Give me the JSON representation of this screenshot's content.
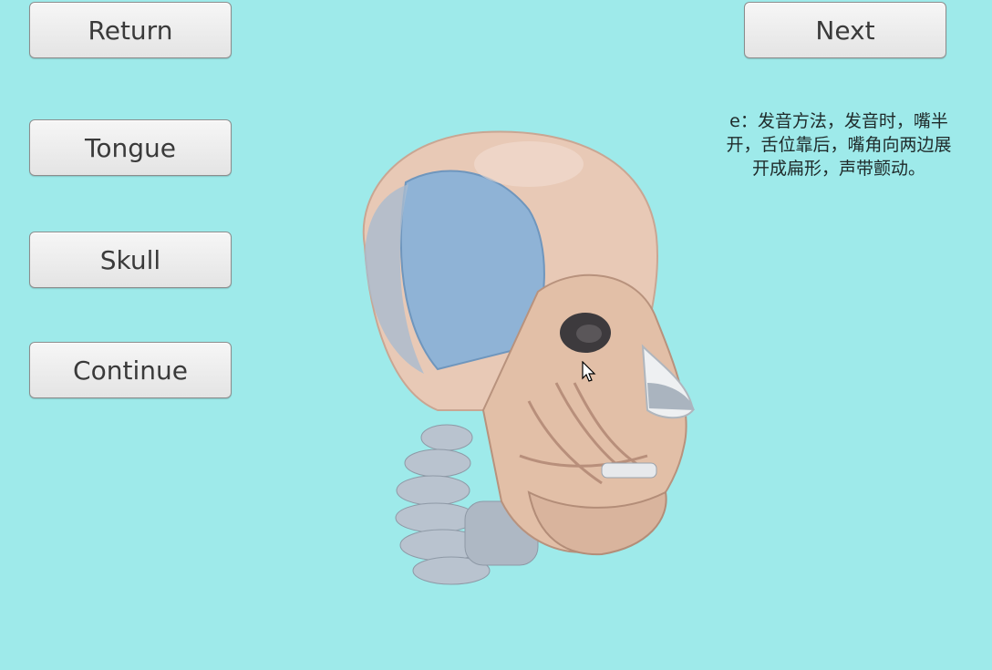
{
  "buttons": {
    "return": "Return",
    "tongue": "Tongue",
    "skull": "Skull",
    "continue": "Continue",
    "next": "Next"
  },
  "description": "e：发音方法，发音时，嘴半\n开，舌位靠后，嘴角向两边展\n开成扁形，声带颤动。",
  "colors": {
    "background": "#9eeaea",
    "button_face": "#eeeeee",
    "skin": "#e5c2ae",
    "muscle_blue": "#8fb3d6"
  },
  "viewport": {
    "model": "head-anatomy-3d-model"
  }
}
